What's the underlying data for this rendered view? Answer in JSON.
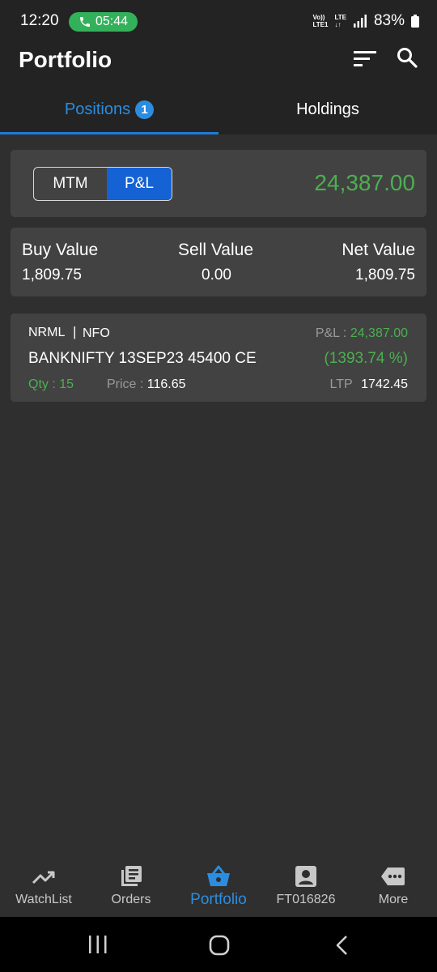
{
  "status_bar": {
    "time": "12:20",
    "call_timer": "05:44",
    "network_top": "Vo))",
    "network_bottom": "LTE1",
    "lte_top": "LTE",
    "lte_bottom": "↓↑",
    "battery": "83%"
  },
  "header": {
    "title": "Portfolio",
    "icons": [
      "filter-icon",
      "search-icon"
    ]
  },
  "tabs": {
    "positions_label": "Positions",
    "positions_count": "1",
    "holdings_label": "Holdings",
    "active": "Positions"
  },
  "pnl_card": {
    "toggle_mtm": "MTM",
    "toggle_pl": "P&L",
    "selected": "P&L",
    "total": "24,387.00"
  },
  "values_card": {
    "buy_label": "Buy Value",
    "buy_value": "1,809.75",
    "sell_label": "Sell Value",
    "sell_value": "0.00",
    "net_label": "Net Value",
    "net_value": "1,809.75"
  },
  "positions": [
    {
      "product": "NRML",
      "separator": "|",
      "exchange": "NFO",
      "pnl_label": "P&L :",
      "pnl_value": "24,387.00",
      "symbol": "BANKNIFTY 13SEP23 45400 CE",
      "pnl_percent": "(1393.74 %)",
      "qty": "Qty : 15",
      "price_label": "Price :",
      "price_value": "116.65",
      "ltp_label": "LTP",
      "ltp_value": "1742.45"
    }
  ],
  "bottom_nav": [
    {
      "label": "WatchList",
      "icon": "trending-up-icon"
    },
    {
      "label": "Orders",
      "icon": "orders-icon"
    },
    {
      "label": "Portfolio",
      "icon": "basket-icon"
    },
    {
      "label": "FT016826",
      "icon": "account-icon"
    },
    {
      "label": "More",
      "icon": "more-icon"
    }
  ],
  "colors": {
    "accent": "#2b8de0",
    "positive": "#4caf50",
    "background": "#2f2f2f",
    "card": "#424242",
    "bar": "#232323"
  }
}
